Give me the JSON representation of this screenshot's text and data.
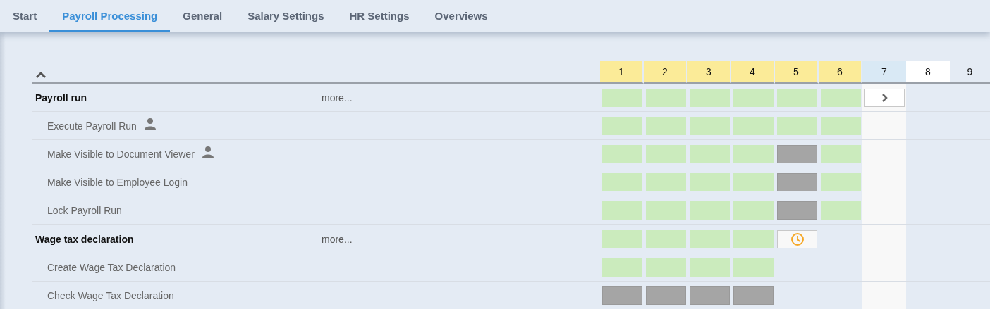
{
  "tabs": [
    {
      "label": "Start",
      "selected": false
    },
    {
      "label": "Payroll Processing",
      "selected": true
    },
    {
      "label": "General",
      "selected": false
    },
    {
      "label": "Salary Settings",
      "selected": false
    },
    {
      "label": "HR Settings",
      "selected": false
    },
    {
      "label": "Overviews",
      "selected": false
    }
  ],
  "months": [
    {
      "label": "1",
      "kind": "past"
    },
    {
      "label": "2",
      "kind": "past"
    },
    {
      "label": "3",
      "kind": "past"
    },
    {
      "label": "4",
      "kind": "past"
    },
    {
      "label": "5",
      "kind": "past"
    },
    {
      "label": "6",
      "kind": "past"
    },
    {
      "label": "7",
      "kind": "current"
    },
    {
      "label": "8",
      "kind": "selected"
    },
    {
      "label": "9",
      "kind": "future"
    }
  ],
  "groups": [
    {
      "title": "Payroll run",
      "more": "more...",
      "cells": [
        {
          "kind": "done"
        },
        {
          "kind": "done"
        },
        {
          "kind": "done"
        },
        {
          "kind": "done"
        },
        {
          "kind": "done"
        },
        {
          "kind": "done"
        },
        {
          "kind": "next"
        }
      ],
      "tasks": [
        {
          "label": "Execute Payroll Run",
          "person": true,
          "cells": [
            {
              "kind": "done"
            },
            {
              "kind": "done"
            },
            {
              "kind": "done"
            },
            {
              "kind": "done"
            },
            {
              "kind": "done"
            },
            {
              "kind": "done"
            }
          ]
        },
        {
          "label": "Make Visible to Document Viewer",
          "person": true,
          "cells": [
            {
              "kind": "done"
            },
            {
              "kind": "done"
            },
            {
              "kind": "done"
            },
            {
              "kind": "done"
            },
            {
              "kind": "inactive"
            },
            {
              "kind": "done"
            }
          ]
        },
        {
          "label": "Make Visible to Employee Login",
          "person": false,
          "cells": [
            {
              "kind": "done"
            },
            {
              "kind": "done"
            },
            {
              "kind": "done"
            },
            {
              "kind": "done"
            },
            {
              "kind": "inactive"
            },
            {
              "kind": "done"
            }
          ]
        },
        {
          "label": "Lock Payroll Run",
          "person": false,
          "cells": [
            {
              "kind": "done"
            },
            {
              "kind": "done"
            },
            {
              "kind": "done"
            },
            {
              "kind": "done"
            },
            {
              "kind": "inactive"
            },
            {
              "kind": "done"
            }
          ]
        }
      ]
    },
    {
      "title": "Wage tax declaration",
      "more": "more...",
      "cells": [
        {
          "kind": "done"
        },
        {
          "kind": "done"
        },
        {
          "kind": "done"
        },
        {
          "kind": "done"
        },
        {
          "kind": "due"
        }
      ],
      "tasks": [
        {
          "label": "Create Wage Tax Declaration",
          "person": false,
          "cells": [
            {
              "kind": "done"
            },
            {
              "kind": "done"
            },
            {
              "kind": "done"
            },
            {
              "kind": "done"
            }
          ]
        },
        {
          "label": "Check Wage Tax Declaration",
          "person": false,
          "cells": [
            {
              "kind": "inactive"
            },
            {
              "kind": "inactive"
            },
            {
              "kind": "inactive"
            },
            {
              "kind": "inactive"
            }
          ]
        }
      ]
    }
  ]
}
